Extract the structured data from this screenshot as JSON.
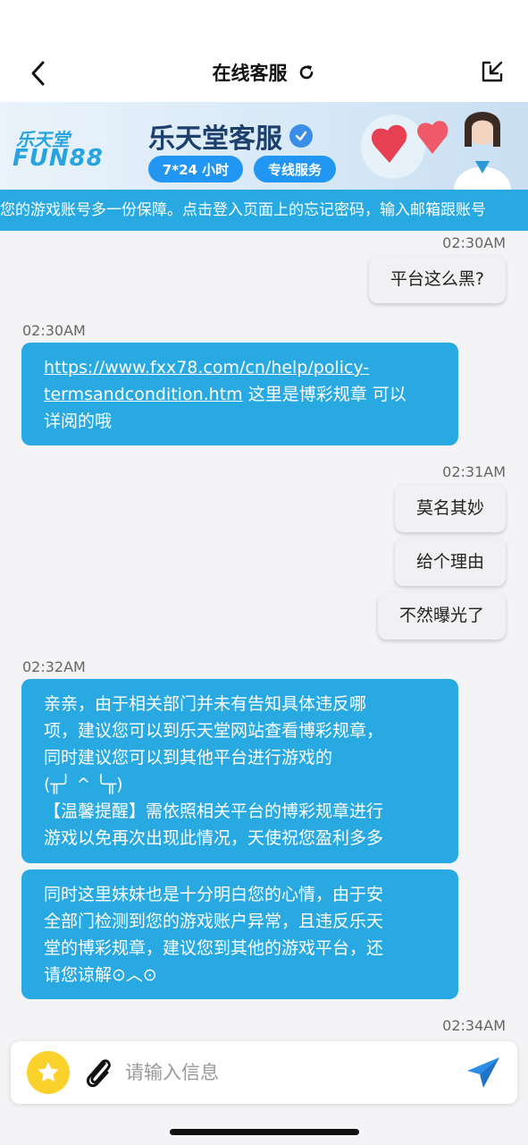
{
  "header": {
    "title": "在线客服",
    "back_icon": "chevron-left-icon",
    "refresh_icon": "refresh-icon",
    "share_icon": "export-icon"
  },
  "banner": {
    "logo_top": "乐天堂",
    "logo_bottom": "FUN88",
    "title": "乐天堂客服",
    "pill_hours": "7*24 小时",
    "pill_service": "专线服务",
    "accent_color": "#27a4df"
  },
  "notice": {
    "text": "您的游戏账号多一份保障。点击登入页面上的忘记密码，输入邮箱跟账号"
  },
  "chat": {
    "msg1": {
      "time": "02:30AM",
      "text": "平台这么黑?"
    },
    "msg2": {
      "time": "02:30AM",
      "link": "https://www.fxx78.com/cn/help/policy-termsandcondition.htm",
      "link_line1": "https://www.fxx78.com/cn/help/policy-",
      "link_line2": "termsandcondition.htm",
      "after_link": " 这里是博彩规章 可以",
      "line3": "详阅的哦"
    },
    "msg3_time": "02:31AM",
    "msg3a": "莫名其妙",
    "msg3b": "给个理由",
    "msg3c": "不然曝光了",
    "msg4": {
      "time": "02:32AM",
      "lines": [
        "亲亲，由于相关部门并未有告知具体违反哪",
        "项，建议您可以到乐天堂网站查看博彩规章，",
        "同时建议您可以到其他平台进行游戏的",
        "(╥╯ ^ ╰╥)",
        "【温馨提醒】需依照相关平台的博彩规章进行",
        "游戏以免再次出现此情况，天使祝您盈利多多"
      ]
    },
    "msg5": {
      "lines": [
        "同时这里妹妹也是十分明白您的心情，由于安",
        "全部门检测到您的游戏账户异常，且违反乐天",
        "堂的博彩规章，建议您到其他的游戏平台，还",
        "请您谅解⊙︿⊙"
      ]
    },
    "msg6_time": "02:34AM",
    "incoming_color": "#29a9e1"
  },
  "composer": {
    "placeholder": "请输入信息",
    "star_icon": "star-icon",
    "attach_icon": "paperclip-icon",
    "send_icon": "send-icon",
    "star_color": "#fbd22c",
    "send_color": "#2d8ee8"
  }
}
